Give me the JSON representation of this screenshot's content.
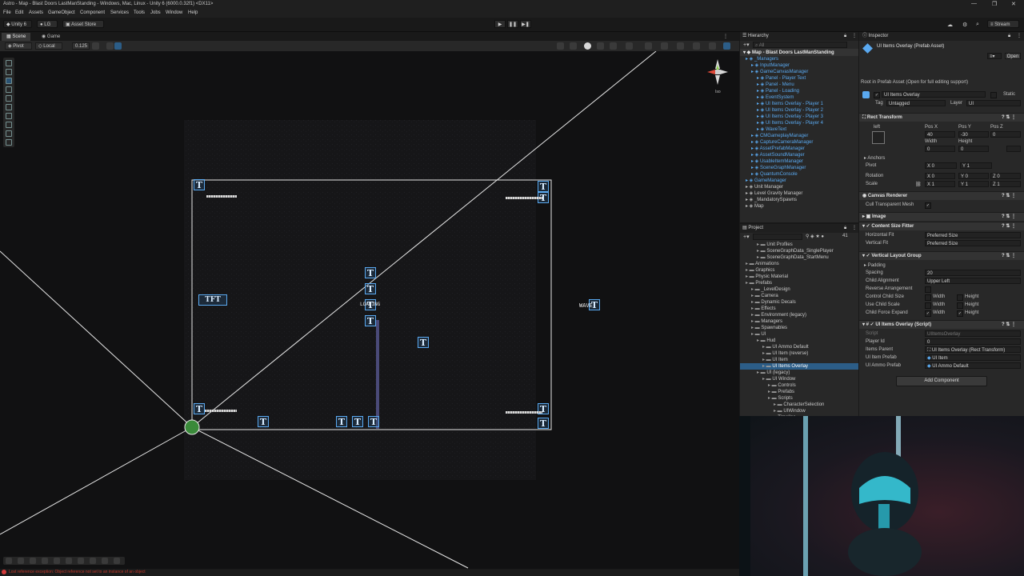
{
  "window": {
    "title": "Astro - Map - Blast Doors LastManStanding - Windows, Mac, Linux - Unity 6 (6000.0.32f1) <DX11>",
    "controls": [
      "—",
      "❐",
      "✕"
    ]
  },
  "menu": [
    "File",
    "Edit",
    "Assets",
    "GameObject",
    "Component",
    "Services",
    "Tools",
    "Jobs",
    "Window",
    "Help"
  ],
  "toolbar": {
    "account": "Unity 6",
    "user": "LG",
    "asset_store": "Asset Store",
    "stream": "Stream"
  },
  "scene": {
    "tabs": [
      {
        "label": "Scene"
      },
      {
        "label": "Game"
      }
    ],
    "pivot": "Pivot",
    "space": "Local",
    "snap": "0.125",
    "persp_label": "Iso",
    "canvas_texts": {
      "loading": "LOADING",
      "wave": "WAVE",
      "tft": "TFT"
    },
    "status_error": "Lost reference exception: Object reference not set to an instance of an object"
  },
  "hierarchy": {
    "title": "Hierarchy",
    "search_placeholder": "All",
    "root": "Map - Blast Doors LastManStanding",
    "items": [
      {
        "label": "_Managers",
        "indent": 1,
        "color": "blue"
      },
      {
        "label": "InputManager",
        "indent": 2,
        "color": "blue"
      },
      {
        "label": "GameCanvasManager",
        "indent": 2,
        "color": "blue"
      },
      {
        "label": "Panel - Player Text",
        "indent": 3,
        "color": "blue"
      },
      {
        "label": "Panel - Menu",
        "indent": 3,
        "color": "blue"
      },
      {
        "label": "Panel - Loading",
        "indent": 3,
        "color": "blue"
      },
      {
        "label": "EventSystem",
        "indent": 3,
        "color": "blue"
      },
      {
        "label": "UI Items Overlay - Player 1",
        "indent": 3,
        "color": "blue"
      },
      {
        "label": "UI Items Overlay - Player 2",
        "indent": 3,
        "color": "blue"
      },
      {
        "label": "UI Items Overlay - Player 3",
        "indent": 3,
        "color": "blue"
      },
      {
        "label": "UI Items Overlay - Player 4",
        "indent": 3,
        "color": "blue"
      },
      {
        "label": "WaveText",
        "indent": 3,
        "color": "blue"
      },
      {
        "label": "CMGameplayManager",
        "indent": 2,
        "color": "blue"
      },
      {
        "label": "CaptureCameraManager",
        "indent": 2,
        "color": "blue"
      },
      {
        "label": "AssetPrefabManager",
        "indent": 2,
        "color": "blue"
      },
      {
        "label": "AssetSoundManager",
        "indent": 2,
        "color": "blue"
      },
      {
        "label": "UsableItemManager",
        "indent": 2,
        "color": "blue"
      },
      {
        "label": "SceneGraphManager",
        "indent": 2,
        "color": "blue"
      },
      {
        "label": "QuantumConsole",
        "indent": 2,
        "color": "blue"
      },
      {
        "label": "GameManager",
        "indent": 1,
        "color": "blue"
      },
      {
        "label": "Unit Manager",
        "indent": 1,
        "color": "white"
      },
      {
        "label": "Level Gravity Manager",
        "indent": 1,
        "color": "white"
      },
      {
        "label": "_MandatorySpawns",
        "indent": 1,
        "color": "white"
      },
      {
        "label": "Map",
        "indent": 1,
        "color": "white"
      }
    ]
  },
  "project": {
    "title": "Project",
    "count": "41",
    "items": [
      {
        "label": "Unit Profiles",
        "indent": 3
      },
      {
        "label": "SceneGraphData_SinglePlayer",
        "indent": 3
      },
      {
        "label": "SceneGraphData_StartMenu",
        "indent": 3
      },
      {
        "label": "Animations",
        "indent": 1
      },
      {
        "label": "Graphics",
        "indent": 1
      },
      {
        "label": "Physic Material",
        "indent": 1
      },
      {
        "label": "Prefabs",
        "indent": 1
      },
      {
        "label": "_LevelDesign",
        "indent": 2
      },
      {
        "label": "Camera",
        "indent": 2
      },
      {
        "label": "Dynamic Decals",
        "indent": 2
      },
      {
        "label": "Effects",
        "indent": 2
      },
      {
        "label": "Environment (legacy)",
        "indent": 2
      },
      {
        "label": "Managers",
        "indent": 2
      },
      {
        "label": "Spawnables",
        "indent": 2
      },
      {
        "label": "UI",
        "indent": 2
      },
      {
        "label": "Hud",
        "indent": 3
      },
      {
        "label": "UI Ammo Default",
        "indent": 4
      },
      {
        "label": "UI Item (reverse)",
        "indent": 4
      },
      {
        "label": "UI Item",
        "indent": 4
      },
      {
        "label": "UI Items Overlay",
        "indent": 4,
        "selected": true
      },
      {
        "label": "UI (legacy)",
        "indent": 3
      },
      {
        "label": "UI Window",
        "indent": 4
      },
      {
        "label": "Controls",
        "indent": 5
      },
      {
        "label": "Prefabs",
        "indent": 5
      },
      {
        "label": "Scripts",
        "indent": 5
      },
      {
        "label": "CharacterSelection",
        "indent": 6
      },
      {
        "label": "UIWindow",
        "indent": 6
      },
      {
        "label": "Timeline",
        "indent": 5
      }
    ]
  },
  "inspector": {
    "title": "Inspector",
    "asset_name": "UI Items Overlay (Prefab Asset)",
    "open_button": "Open",
    "prefab_note": "Root in Prefab Asset (Open for full editing support)",
    "object_name": "UI Items Overlay",
    "static_label": "Static",
    "tag_label": "Tag",
    "tag_value": "Untagged",
    "layer_label": "Layer",
    "layer_value": "UI",
    "rect_transform": {
      "header": "Rect Transform",
      "anchor_label": "left",
      "pos_x_label": "Pos X",
      "pos_y_label": "Pos Y",
      "pos_z_label": "Pos Z",
      "pos_x": "40",
      "pos_y": "-30",
      "pos_z": "0",
      "width_label": "Width",
      "height_label": "Height",
      "width": "0",
      "height": "0",
      "anchors_label": "Anchors",
      "pivot_label": "Pivot",
      "pivot_x": "0",
      "pivot_y": "1",
      "rotation_label": "Rotation",
      "rot_x": "0",
      "rot_y": "0",
      "rot_z": "0",
      "scale_label": "Scale",
      "scale_x": "1",
      "scale_y": "1",
      "scale_z": "1"
    },
    "canvas_renderer": {
      "header": "Canvas Renderer",
      "cull_label": "Cull Transparent Mesh"
    },
    "image": {
      "header": "Image"
    },
    "content_size_fitter": {
      "header": "Content Size Fitter",
      "hfit_label": "Horizontal Fit",
      "hfit_value": "Preferred Size",
      "vfit_label": "Vertical Fit",
      "vfit_value": "Preferred Size"
    },
    "vertical_layout": {
      "header": "Vertical Layout Group",
      "padding_label": "Padding",
      "spacing_label": "Spacing",
      "spacing_value": "20",
      "child_alignment_label": "Child Alignment",
      "child_alignment_value": "Upper Left",
      "reverse_label": "Reverse Arrangement",
      "control_size_label": "Control Child Size",
      "use_scale_label": "Use Child Scale",
      "force_expand_label": "Child Force Expand",
      "width_label": "Width",
      "height_label": "Height"
    },
    "script": {
      "header": "UI Items Overlay (Script)",
      "script_label": "Script",
      "script_value": "UIItemsOverlay",
      "player_id_label": "Player Id",
      "player_id_value": "0",
      "items_parent_label": "Items Parent",
      "items_parent_value": "UI Items Overlay (Rect Transform)",
      "item_prefab_label": "UI Item Prefab",
      "item_prefab_value": "UI Item",
      "ammo_prefab_label": "UI Ammo Prefab",
      "ammo_prefab_value": "UI Ammo Default"
    },
    "add_component": "Add Component"
  },
  "colors": {
    "accent": "#5aa9f0",
    "selection": "#2c5d87",
    "background": "#191919",
    "panel": "#282828"
  }
}
